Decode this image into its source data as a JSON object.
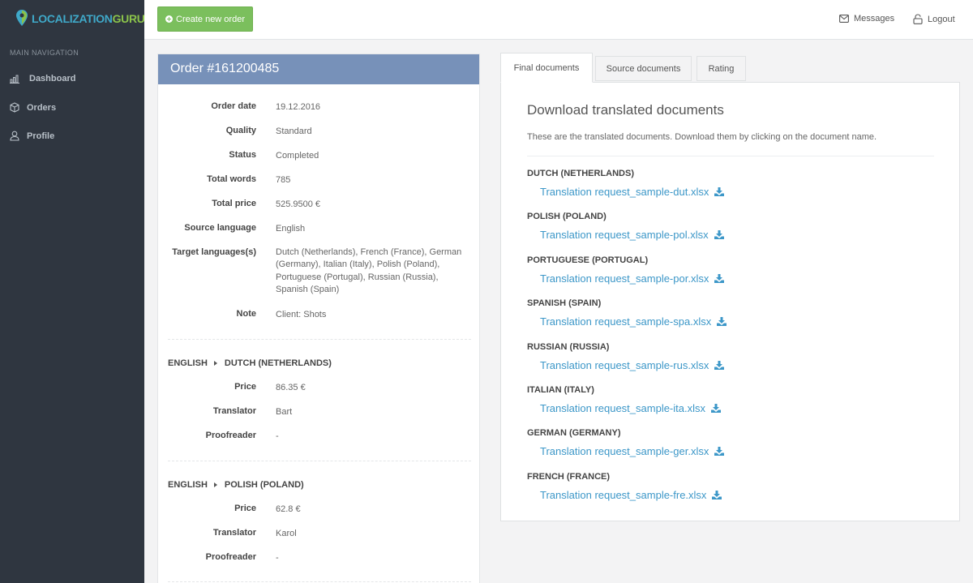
{
  "brand": {
    "part1": "LOCALIZATION",
    "part2": "GURU"
  },
  "sidebar": {
    "heading": "MAIN NAVIGATION",
    "items": [
      {
        "label": "Dashboard",
        "icon": "bar-chart-icon"
      },
      {
        "label": "Orders",
        "icon": "box-icon"
      },
      {
        "label": "Profile",
        "icon": "user-icon"
      }
    ]
  },
  "topbar": {
    "create_label": "Create new order",
    "messages_label": "Messages",
    "logout_label": "Logout"
  },
  "order": {
    "title": "Order #161200485",
    "fields": [
      {
        "label": "Order date",
        "value": "19.12.2016"
      },
      {
        "label": "Quality",
        "value": "Standard"
      },
      {
        "label": "Status",
        "value": "Completed"
      },
      {
        "label": "Total words",
        "value": "785"
      },
      {
        "label": "Total price",
        "value": "525.9500 €"
      },
      {
        "label": "Source language",
        "value": "English"
      },
      {
        "label": "Target languages(s)",
        "value": "Dutch (Netherlands), French (France), German (Germany), Italian (Italy), Polish (Poland), Portuguese (Portugal), Russian (Russia), Spanish (Spain)"
      },
      {
        "label": "Note",
        "value": "Client: Shots"
      }
    ],
    "pairs": [
      {
        "source": "ENGLISH",
        "target": "DUTCH (NETHERLANDS)",
        "price_label": "Price",
        "price": "86.35 €",
        "translator_label": "Translator",
        "translator": "Bart",
        "proofreader_label": "Proofreader",
        "proofreader": "-"
      },
      {
        "source": "ENGLISH",
        "target": "POLISH (POLAND)",
        "price_label": "Price",
        "price": "62.8 €",
        "translator_label": "Translator",
        "translator": "Karol",
        "proofreader_label": "Proofreader",
        "proofreader": "-"
      }
    ]
  },
  "tabs": {
    "final": "Final documents",
    "source": "Source documents",
    "rating": "Rating",
    "active": "final"
  },
  "documents": {
    "title": "Download translated documents",
    "subtitle": "These are the translated documents. Download them by clicking on the document name.",
    "items": [
      {
        "language": "DUTCH (NETHERLANDS)",
        "file": "Translation request_sample-dut.xlsx"
      },
      {
        "language": "POLISH (POLAND)",
        "file": "Translation request_sample-pol.xlsx"
      },
      {
        "language": "PORTUGUESE (PORTUGAL)",
        "file": "Translation request_sample-por.xlsx"
      },
      {
        "language": "SPANISH (SPAIN)",
        "file": "Translation request_sample-spa.xlsx"
      },
      {
        "language": "RUSSIAN (RUSSIA)",
        "file": "Translation request_sample-rus.xlsx"
      },
      {
        "language": "ITALIAN (ITALY)",
        "file": "Translation request_sample-ita.xlsx"
      },
      {
        "language": "GERMAN (GERMANY)",
        "file": "Translation request_sample-ger.xlsx"
      },
      {
        "language": "FRENCH (FRANCE)",
        "file": "Translation request_sample-fre.xlsx"
      }
    ]
  },
  "colors": {
    "sidebar": "#2f3640",
    "create_button": "#7bbf5d",
    "order_header": "#7791b9",
    "link": "#3c97c8"
  }
}
